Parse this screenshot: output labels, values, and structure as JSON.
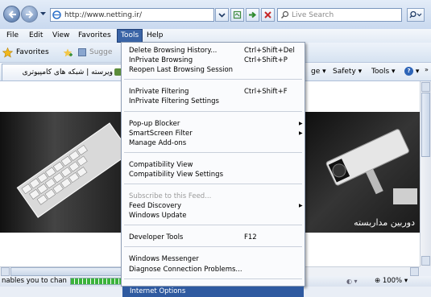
{
  "address_bar": {
    "url": "http://www.netting.ir/",
    "search_placeholder": "Live Search"
  },
  "menu_bar": {
    "file": "File",
    "edit": "Edit",
    "view": "View",
    "favorites": "Favorites",
    "tools": "Tools",
    "help": "Help"
  },
  "favorites_bar": {
    "favorites_label": "Favorites",
    "suggested_label": "Sugge"
  },
  "tab": {
    "title": "ویرسته | شبکه های کامپیوتری"
  },
  "command_bar": {
    "page": "ge ▾",
    "safety": "Safety ▾",
    "tools": "Tools ▾",
    "help_symbol": "?",
    "help_caret": "▾",
    "more": "»"
  },
  "content": {
    "banner_caption": "دوربین مداربسته"
  },
  "status_bar": {
    "text": "nables you to chan",
    "progress_fraction": 0.95,
    "zoom_label": "100%",
    "zoom_caret": "▾",
    "zone_icons": "◐ ▾"
  },
  "tools_menu": {
    "groups": [
      [
        {
          "label": "Delete Browsing History...",
          "shortcut": "Ctrl+Shift+Del"
        },
        {
          "label": "InPrivate Browsing",
          "shortcut": "Ctrl+Shift+P"
        },
        {
          "label": "Reopen Last Browsing Session",
          "shortcut": ""
        }
      ],
      [
        {
          "label": "InPrivate Filtering",
          "shortcut": "Ctrl+Shift+F"
        },
        {
          "label": "InPrivate Filtering Settings",
          "shortcut": ""
        }
      ],
      [
        {
          "label": "Pop-up Blocker",
          "shortcut": "",
          "submenu": true
        },
        {
          "label": "SmartScreen Filter",
          "shortcut": "",
          "submenu": true
        },
        {
          "label": "Manage Add-ons",
          "shortcut": ""
        }
      ],
      [
        {
          "label": "Compatibility View",
          "shortcut": ""
        },
        {
          "label": "Compatibility View Settings",
          "shortcut": ""
        }
      ],
      [
        {
          "label": "Subscribe to this Feed...",
          "shortcut": "",
          "disabled": true
        },
        {
          "label": "Feed Discovery",
          "shortcut": "",
          "submenu": true
        },
        {
          "label": "Windows Update",
          "shortcut": ""
        }
      ],
      [
        {
          "label": "Developer Tools",
          "shortcut": "F12"
        }
      ],
      [
        {
          "label": "Windows Messenger",
          "shortcut": ""
        },
        {
          "label": "Diagnose Connection Problems...",
          "shortcut": ""
        }
      ],
      [
        {
          "label": "Internet Options",
          "shortcut": "",
          "highlighted": true
        }
      ]
    ]
  },
  "colors": {
    "menu_highlight": "#2f5aa0",
    "tools_menu_active": "#3a64a6",
    "progress_green": "#3bb33b"
  }
}
